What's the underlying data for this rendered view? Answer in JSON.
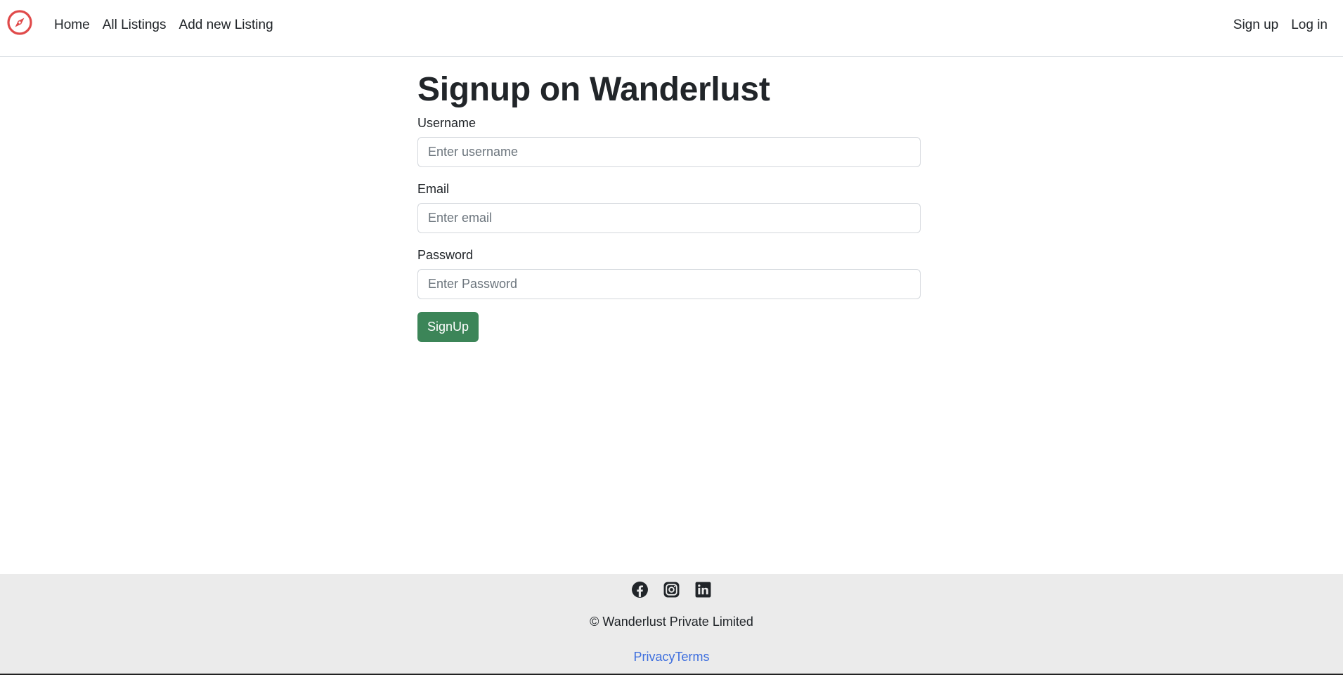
{
  "navbar": {
    "brand_icon": "compass-icon",
    "brand_color": "#e04a4a",
    "left_links": [
      "Home",
      "All Listings",
      "Add new Listing"
    ],
    "right_links": [
      "Sign up",
      "Log in"
    ]
  },
  "form": {
    "title": "Signup on Wanderlust",
    "username": {
      "label": "Username",
      "placeholder": "Enter username",
      "value": ""
    },
    "email": {
      "label": "Email",
      "placeholder": "Enter email",
      "value": ""
    },
    "password": {
      "label": "Password",
      "placeholder": "Enter Password",
      "value": ""
    },
    "submit_label": "SignUp",
    "submit_color": "#3c8558"
  },
  "footer": {
    "social_icons": [
      "facebook-icon",
      "instagram-icon",
      "linkedin-icon"
    ],
    "copyright": "© Wanderlust Private Limited",
    "links": [
      "Privacy",
      "Terms"
    ],
    "link_color": "#3d6ede",
    "background": "#ebebeb"
  }
}
